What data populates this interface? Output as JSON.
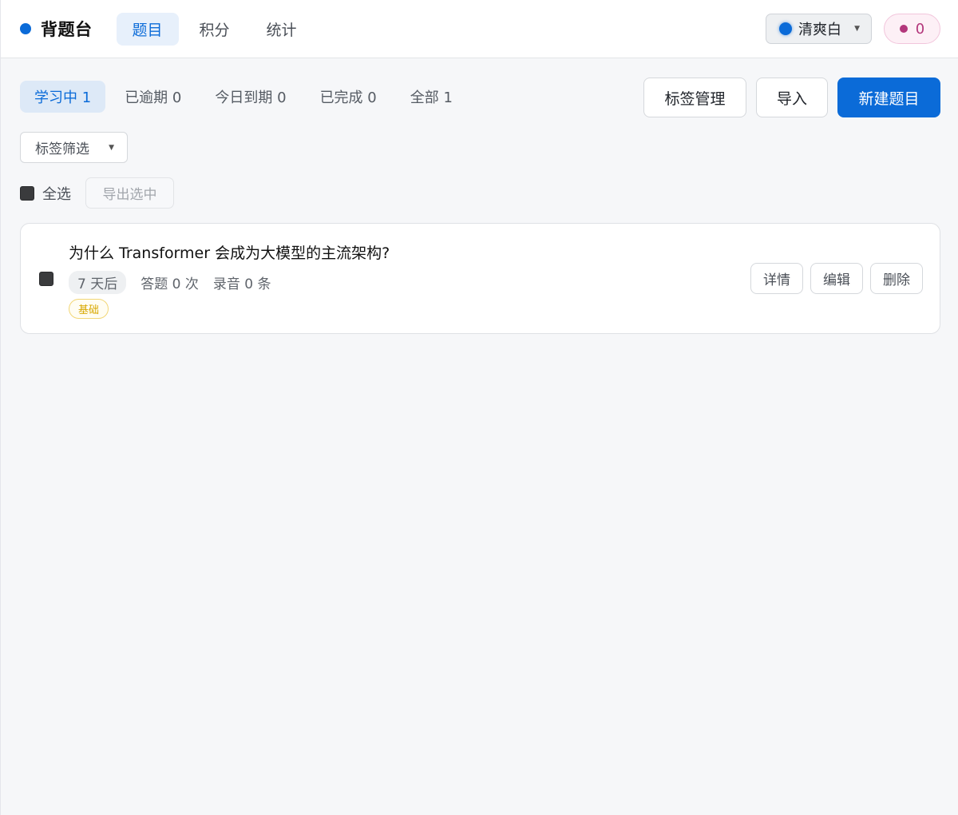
{
  "header": {
    "brand": "背题台",
    "tabs": [
      {
        "label": "题目",
        "active": true
      },
      {
        "label": "积分",
        "active": false
      },
      {
        "label": "统计",
        "active": false
      }
    ],
    "theme": {
      "label": "清爽白",
      "color": "#0b6bd8"
    },
    "points": {
      "value": "0",
      "color": "#b3367b"
    }
  },
  "toolbar": {
    "filters": [
      {
        "label": "学习中 1",
        "active": true
      },
      {
        "label": "已逾期 0",
        "active": false
      },
      {
        "label": "今日到期 0",
        "active": false
      },
      {
        "label": "已完成 0",
        "active": false
      },
      {
        "label": "全部 1",
        "active": false
      }
    ],
    "tag_manage_label": "标签管理",
    "import_label": "导入",
    "new_label": "新建题目"
  },
  "tag_filter": {
    "label": "标签筛选"
  },
  "selection": {
    "select_all_label": "全选",
    "export_label": "导出选中"
  },
  "questions": [
    {
      "title": "为什么 Transformer 会成为大模型的主流架构?",
      "due": "7 天后",
      "answers": "答题 0 次",
      "recordings": "录音 0 条",
      "tag": "基础",
      "actions": {
        "detail": "详情",
        "edit": "编辑",
        "delete": "删除"
      }
    }
  ],
  "colors": {
    "accent": "#0b6bd8",
    "tag": "#d8a800"
  }
}
